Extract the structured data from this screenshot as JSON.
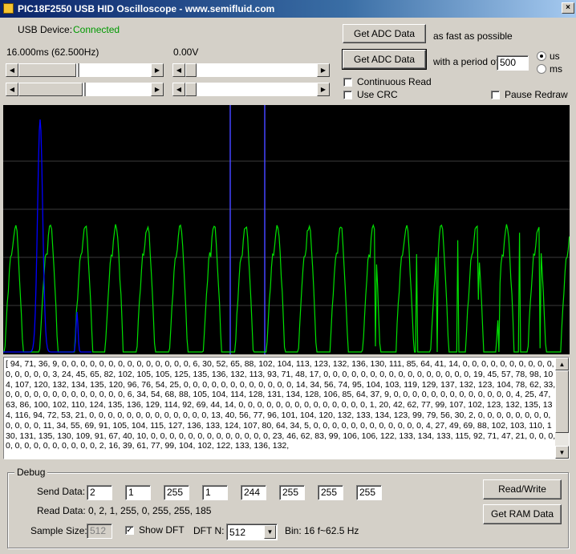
{
  "window": {
    "title": "PIC18F2550 USB HID Oscilloscope - www.semifluid.com",
    "close_glyph": "×"
  },
  "usb": {
    "label": "USB Device:",
    "status": "Connected",
    "status_color": "#009900"
  },
  "time_readout": "16.000ms (62.500Hz)",
  "volt_readout": "0.00V",
  "buttons": {
    "get_adc_1": "Get ADC Data",
    "get_adc_2": "Get ADC Data",
    "read_write": "Read/Write",
    "get_ram": "Get RAM Data"
  },
  "labels": {
    "fast": "as fast as possible",
    "period": "with a period of",
    "us": "us",
    "ms": "ms"
  },
  "period_value": "500",
  "unit_selected": "us",
  "checkboxes": {
    "continuous_read": {
      "label": "Continuous Read",
      "checked": false
    },
    "use_crc": {
      "label": "Use CRC",
      "checked": false
    },
    "pause_redraw": {
      "label": "Pause Redraw",
      "checked": false
    },
    "show_dft": {
      "label": "Show DFT",
      "checked": true
    }
  },
  "sliders": [
    {
      "name": "timebase-slider",
      "value": 0.23
    },
    {
      "name": "offset-slider",
      "value": 0.35
    },
    {
      "name": "voltage-slider",
      "value": 0.08
    },
    {
      "name": "trigger-slider",
      "value": 0.08
    }
  ],
  "scope": {
    "background": "#000000",
    "grid_color": "#3a3a3a",
    "wave_color": "#00e000",
    "dft_color": "#0000ff",
    "cursor_color": "#4444ff",
    "peaks": 19,
    "wave_min": 0,
    "wave_max": 136
  },
  "data_text": "[ 94, 71, 36, 9, 0, 0, 0, 0, 0, 0, 0, 0, 0, 0, 0, 0, 0, 0, 6, 30, 52, 65, 88, 102, 104, 113, 123, 132, 136, 130, 111, 85, 64, 41, 14, 0, 0, 0, 0, 0, 0, 0, 0, 0, 0, 0, 0, 0, 0, 0, 3, 24, 45, 65, 82, 102, 105, 105, 125, 135, 136, 132, 113, 93, 71, 48, 17, 0, 0, 0, 0, 0, 0, 0, 0, 0, 0, 0, 0, 0, 0, 0, 0, 19, 45, 57, 78, 98, 104, 107, 120, 132, 134, 135, 120, 96, 76, 54, 25, 0, 0, 0, 0, 0, 0, 0, 0, 0, 0, 0, 0, 14, 34, 56, 74, 95, 104, 103, 119, 129, 137, 132, 123, 104, 78, 62, 33, 0, 0, 0, 0, 0, 0, 0, 0, 0, 0, 0, 0, 0, 6, 34, 54, 68, 88, 105, 104, 114, 128, 131, 134, 128, 106, 85, 64, 37, 9, 0, 0, 0, 0, 0, 0, 0, 0, 0, 0, 0, 0, 0, 4, 25, 47, 63, 86, 100, 102, 110, 124, 135, 136, 129, 114, 92, 69, 44, 14, 0, 0, 0, 0, 0, 0, 0, 0, 0, 0, 0, 0, 0, 0, 1, 20, 42, 62, 77, 99, 107, 102, 123, 132, 135, 134, 116, 94, 72, 53, 21, 0, 0, 0, 0, 0, 0, 0, 0, 0, 0, 0, 0, 0, 13, 40, 56, 77, 96, 101, 104, 120, 132, 133, 134, 123, 99, 79, 56, 30, 2, 0, 0, 0, 0, 0, 0, 0, 0, 0, 0, 0, 0, 11, 34, 55, 69, 91, 105, 104, 115, 127, 136, 133, 124, 107, 80, 64, 34, 5, 0, 0, 0, 0, 0, 0, 0, 0, 0, 0, 0, 0, 4, 27, 49, 69, 88, 102, 103, 110, 130, 131, 135, 130, 109, 91, 67, 40, 10, 0, 0, 0, 0, 0, 0, 0, 0, 0, 0, 0, 0, 0, 23, 46, 62, 83, 99, 106, 106, 122, 133, 134, 133, 115, 92, 71, 47, 21, 0, 0, 0, 0, 0, 0, 0, 0, 0, 0, 0, 0, 0, 2, 16, 39, 61, 77, 99, 104, 102, 122, 133, 136, 132,",
  "debug": {
    "group_label": "Debug",
    "send_label": "Send Data:",
    "send_values": [
      "2",
      "1",
      "255",
      "1",
      "244",
      "255",
      "255",
      "255"
    ],
    "read_label": "Read Data:",
    "read_value": "0, 2, 1, 255, 0, 255, 255, 185",
    "sample_label": "Sample Size:",
    "sample_value": "512",
    "dftn_label": "DFT N:",
    "dftn_value": "512",
    "bin_text": "Bin: 16 f~62.5 Hz"
  }
}
